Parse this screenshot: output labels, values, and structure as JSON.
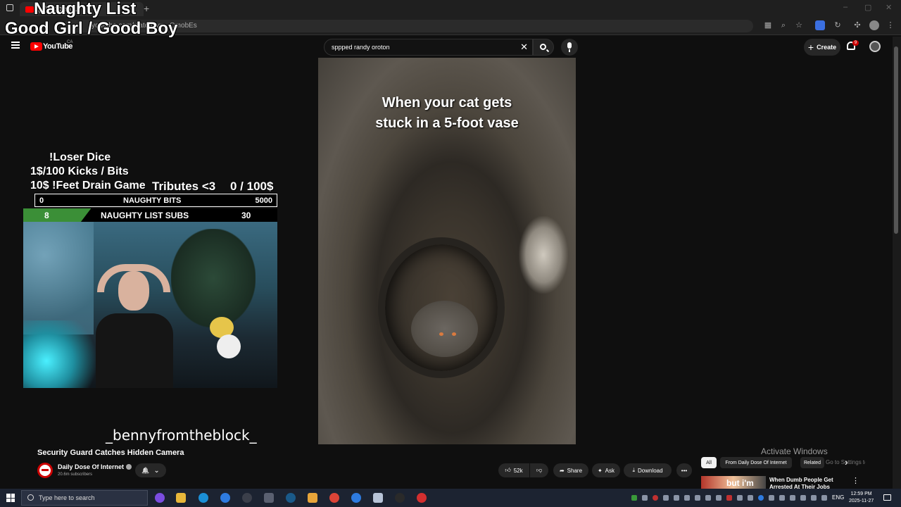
{
  "browser": {
    "tab_title": "(4) spped...",
    "new_tab": "+",
    "url": "youtube.com/watch?v=...QmobEs",
    "controls": [
      "–",
      "▢",
      "✕"
    ]
  },
  "youtube": {
    "logo_text": "YouTube",
    "country_code": "CA",
    "search_query": "sppped randy oroton",
    "clear_glyph": "✕",
    "create_label": "Create",
    "create_plus": "+",
    "notification_count": "9"
  },
  "overlay": {
    "title_line1": "Naughty List",
    "title_line2": "Good Girl / Good Boy",
    "loser_dice": "!Loser Dice",
    "kicks_bits": "1$/100 Kicks / Bits",
    "feet_drain": "10$ !Feet Drain Game",
    "tributes": "Tributes <3",
    "tribute_progress": "0 / 100$",
    "bits_bar": {
      "min": "0",
      "label": "NAUGHTY BITS",
      "max": "5000",
      "fill_fraction": 0
    },
    "subs_bar": {
      "current": "8",
      "label": "NAUGHTY LIST SUBS",
      "max": "30",
      "fill_fraction": 0.267
    },
    "streamer_name": "_bennyfromtheblock_"
  },
  "video": {
    "caption_line1": "When your cat gets",
    "caption_line2": "stuck in a 5-foot vase",
    "title": "Security Guard Catches Hidden Camera",
    "channel_name": "Daily Dose Of Internet",
    "subscribers": "20.6m subscribers",
    "bell_glyph": "🔔",
    "chevron_glyph": "⌄",
    "like_count": "52k",
    "share_label": "Share",
    "ask_label": "Ask",
    "download_label": "Download",
    "more_glyph": "•••"
  },
  "sidebar": {
    "chips": [
      "All",
      "From Daily Dose Of Internet",
      "Related"
    ],
    "next_glyph": "›",
    "rec_title": "When Dumb People Get Arrested At Their Jobs",
    "rec_thumb_text": "but i'm",
    "rec_more": "⋮"
  },
  "activation": {
    "title": "Activate Windows",
    "subtitle": "Go to Settings to activate Windows."
  },
  "taskbar": {
    "search_placeholder": "Type here to search",
    "language": "ENG",
    "time": "12:59 PM",
    "date": "2025-11-27"
  },
  "colors": {
    "yt_red": "#ff0000",
    "subs_green": "#3b8f37",
    "background": "#0f0f0f"
  }
}
